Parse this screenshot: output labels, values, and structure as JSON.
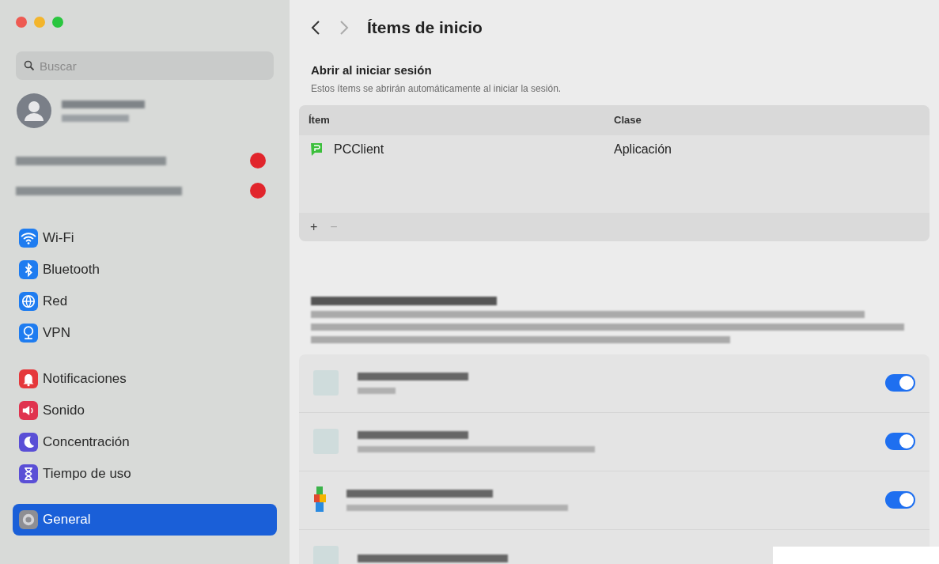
{
  "window": {
    "title": "Ítems de inicio"
  },
  "sidebar": {
    "search": {
      "placeholder": "Buscar"
    },
    "alerts": [
      {
        "badge": true
      },
      {
        "badge": true
      }
    ],
    "groups": [
      [
        {
          "label": "Wi-Fi",
          "color": "#1e7cf0",
          "selected": false
        },
        {
          "label": "Bluetooth",
          "color": "#1e7cf0",
          "selected": false
        },
        {
          "label": "Red",
          "color": "#1e7cf0",
          "selected": false
        },
        {
          "label": "VPN",
          "color": "#1e7cf0",
          "selected": false
        }
      ],
      [
        {
          "label": "Notificaciones",
          "color": "#e5383b",
          "selected": false
        },
        {
          "label": "Sonido",
          "color": "#e0334f",
          "selected": false
        },
        {
          "label": "Concentración",
          "color": "#5a4fd6",
          "selected": false
        },
        {
          "label": "Tiempo de uso",
          "color": "#5a4fd6",
          "selected": false
        }
      ],
      [
        {
          "label": "General",
          "color": "#8e8e93",
          "selected": true
        }
      ]
    ]
  },
  "login_items": {
    "heading": "Abrir al iniciar sesión",
    "description": "Estos ítems se abrirán automáticamente al iniciar la sesión.",
    "columns": [
      "Ítem",
      "Clase"
    ],
    "rows": [
      {
        "name": "PCClient",
        "class": "Aplicación",
        "selected": false
      }
    ],
    "add": "+",
    "remove": "−"
  },
  "background_items": [
    {
      "kind": "blank",
      "on": true
    },
    {
      "kind": "blank",
      "on": true
    },
    {
      "kind": "colorful",
      "on": true
    },
    {
      "kind": "blank"
    }
  ]
}
